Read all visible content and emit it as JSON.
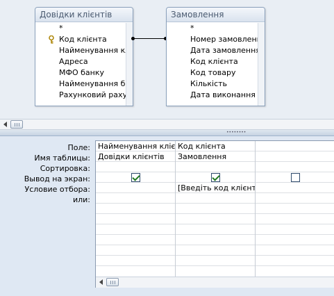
{
  "diagram": {
    "tables": [
      {
        "title": "Довідки клієнтів",
        "fields": [
          "*",
          "Код клієнта",
          "Найменування клієнта",
          "Адреса",
          "МФО банку",
          "Найменування банку",
          "Рахунковий рахунок"
        ],
        "key_field_index": 1
      },
      {
        "title": "Замовлення",
        "fields": [
          "*",
          "Номер замовлення",
          "Дата замовлення",
          "Код клієнта",
          "Код товару",
          "Кількість",
          "Дата виконання"
        ]
      }
    ]
  },
  "grid": {
    "row_labels": [
      "Поле:",
      "Имя таблицы:",
      "Сортировка:",
      "Вывод на экран:",
      "Условие отбора:",
      "или:"
    ],
    "columns": [
      {
        "field": "Найменування клієнта",
        "table": "Довідки клієнтів",
        "sort": "",
        "show": true,
        "criteria": ""
      },
      {
        "field": "Код клієнта",
        "table": "Замовлення",
        "sort": "",
        "show": true,
        "criteria": "[Введіть код  клієнта]"
      },
      {
        "field": "",
        "table": "",
        "sort": "",
        "show": false,
        "criteria": ""
      }
    ]
  },
  "icons": {
    "key": "key-icon",
    "scroll_left": "arrow-left-icon",
    "scroll_thumb": "scroll-thumb"
  }
}
